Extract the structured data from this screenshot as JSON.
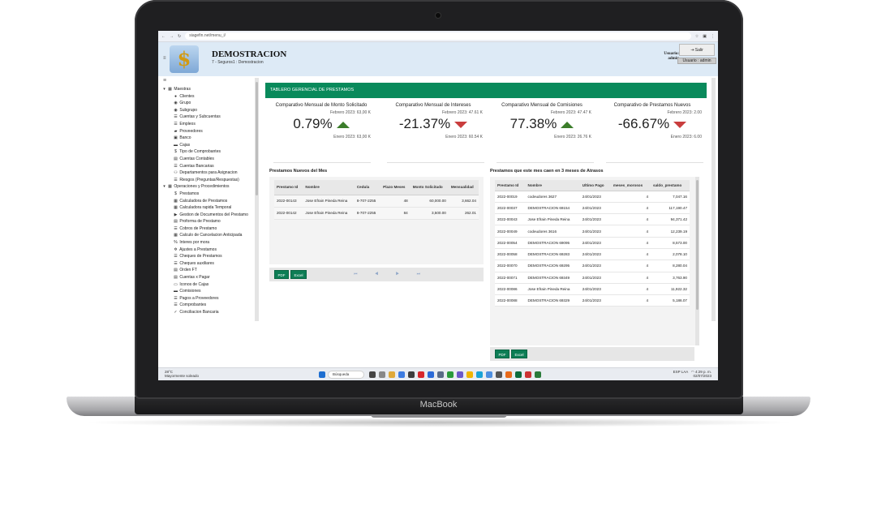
{
  "device": {
    "brand": "MacBook"
  },
  "browser": {
    "url": "siagefin.net/menu_i/"
  },
  "app": {
    "title": "DEMOSTRACION",
    "subtitle": "7 - Seguros1 : Demostracion",
    "user_label": "Usuario:",
    "user_name": "admin",
    "logout_label": "Salir",
    "user_button": "Usuario : admin"
  },
  "sidebar": {
    "items": [
      {
        "label": "Maestras",
        "icon": "grid-icon",
        "level": 0
      },
      {
        "label": "Clientes",
        "icon": "user-icon",
        "level": 1
      },
      {
        "label": "Grupo",
        "icon": "group-icon",
        "level": 1
      },
      {
        "label": "Subgrupo",
        "icon": "group-icon",
        "level": 1
      },
      {
        "label": "Cuentas y Subcuentas",
        "icon": "list-icon",
        "level": 1
      },
      {
        "label": "Empleos",
        "icon": "list-icon",
        "level": 1
      },
      {
        "label": "Proveedores",
        "icon": "truck-icon",
        "level": 1
      },
      {
        "label": "Banco",
        "icon": "bank-icon",
        "level": 1
      },
      {
        "label": "Cajas",
        "icon": "cash-icon",
        "level": 1
      },
      {
        "label": "Tipo de Comprobantes",
        "icon": "dollar-icon",
        "level": 1
      },
      {
        "label": "Cuentas Contables",
        "icon": "book-icon",
        "level": 1
      },
      {
        "label": "Cuentas Bancarias",
        "icon": "list-icon",
        "level": 1
      },
      {
        "label": "Departamentos para Asignacion",
        "icon": "org-icon",
        "level": 1
      },
      {
        "label": "Riesgos (Preguntas/Respuestas)",
        "icon": "list-icon",
        "level": 1
      },
      {
        "label": "Operaciones y Procedimientos",
        "icon": "grid-icon",
        "level": 0
      },
      {
        "label": "Prestamos",
        "icon": "dollar-icon",
        "level": 1
      },
      {
        "label": "Calculadora de Prestamos",
        "icon": "calc-icon",
        "level": 1
      },
      {
        "label": "Calculadora rapida Temporal",
        "icon": "calc-icon",
        "level": 1
      },
      {
        "label": "Gestion de Documentos del Prestamo",
        "icon": "folder-icon",
        "level": 1
      },
      {
        "label": "Proforma de Prestamo",
        "icon": "doc-icon",
        "level": 1
      },
      {
        "label": "Cobros de Prestamo",
        "icon": "list-icon",
        "level": 1
      },
      {
        "label": "Calculo de Cancelacion Anticipada",
        "icon": "calc-icon",
        "level": 1
      },
      {
        "label": "Interes por mora",
        "icon": "percent-icon",
        "level": 1
      },
      {
        "label": "Ajustes a Prestamos",
        "icon": "gear-icon",
        "level": 1
      },
      {
        "label": "Cheques de Prestamos",
        "icon": "list-icon",
        "level": 1
      },
      {
        "label": "Cheques auxiliares",
        "icon": "list-icon",
        "level": 1
      },
      {
        "label": "Orden FT",
        "icon": "doc-icon",
        "level": 1
      },
      {
        "label": "Cuentas x Pagar",
        "icon": "doc-icon",
        "level": 1
      },
      {
        "label": "Iconos de Cajas",
        "icon": "monitor-icon",
        "level": 1
      },
      {
        "label": "Comisiones",
        "icon": "cash-icon",
        "level": 1
      },
      {
        "label": "Pagos a Proveedores",
        "icon": "list-icon",
        "level": 1
      },
      {
        "label": "Comprobantes",
        "icon": "list-icon",
        "level": 1
      },
      {
        "label": "Conciliacion Bancaria",
        "icon": "check-icon",
        "level": 1
      }
    ]
  },
  "dashboard": {
    "banner": "TABLERO GERENCIAL DE PRESTAMOS",
    "kpis": [
      {
        "title": "Comparativo Mensual de Monto Solicitado",
        "prev": "Febrero 2023: 63,00 K",
        "value": "0.79%",
        "trend": "up",
        "curr": "Enero 2023: 63,00 K"
      },
      {
        "title": "Comparativo Mensual de Intereses",
        "prev": "Febrero 2023: 47.61 K",
        "value": "-21.37%",
        "trend": "down",
        "curr": "Enero 2023: 60.54 K"
      },
      {
        "title": "Comparativo Mensual de Comisiones",
        "prev": "Febrero 2023: 47.47 K",
        "value": "77.38%",
        "trend": "up",
        "curr": "Enero 2023: 26.76 K"
      },
      {
        "title": "Comparativo de Prestamos Nuevos",
        "prev": "Febrero 2023: 2.00",
        "value": "-66.67%",
        "trend": "down",
        "curr": "Enero 2023: 6.00"
      }
    ],
    "new_loans": {
      "title": "Prestamos Nuevos del Mes",
      "headers": [
        "Prestamo Id",
        "Nombre",
        "Cedula",
        "Plazo Meses",
        "Monto Solicitado",
        "Mensualidad"
      ],
      "rows": [
        [
          "2022-00143",
          "Jose Efrain Pineda Reina",
          "8-707-2255",
          "48",
          "60,000.00",
          "3,662.04"
        ],
        [
          "2022-00142",
          "Jose Efrain Pineda Reina",
          "8-707-2255",
          "84",
          "3,500.00",
          "262.01"
        ]
      ],
      "pdf": "PDF",
      "excel": "Excel",
      "pager": "⏮ ◀ ▶ ⏭"
    },
    "arrears": {
      "title": "Prestamos que este mes caen en 3 meses de Atrasos",
      "headers": [
        "Prestamo Id",
        "Nombre",
        "Ultimo Pago",
        "meses_morosos",
        "saldo_prestamo"
      ],
      "rows": [
        [
          "2022-00019",
          "codeudores 3627",
          "24/01/2023",
          "4",
          "7,047.16"
        ],
        [
          "2022-00037",
          "DEMOSTRACION 69154",
          "24/01/2023",
          "4",
          "117,190.47"
        ],
        [
          "2022-00043",
          "Jose Efrain Pineda Reina",
          "24/01/2023",
          "4",
          "94,371.42"
        ],
        [
          "2022-00049",
          "codeudores 3616",
          "24/01/2023",
          "4",
          "12,239.19"
        ],
        [
          "2022-00054",
          "DEMOSTRACION 69095",
          "24/01/2023",
          "4",
          "8,573.00"
        ],
        [
          "2022-00058",
          "DEMOSTRACION 69283",
          "24/01/2023",
          "4",
          "2,078.10"
        ],
        [
          "2022-00070",
          "DEMOSTRACION 69295",
          "24/01/2023",
          "4",
          "8,280.04"
        ],
        [
          "2022-00071",
          "DEMOSTRACION 69349",
          "24/01/2023",
          "4",
          "3,763.90"
        ],
        [
          "2022-00086",
          "Jose Efrain Pineda Reina",
          "24/01/2023",
          "4",
          "11,922.32"
        ],
        [
          "2022-00088",
          "DEMOSTRACION 69329",
          "24/01/2023",
          "4",
          "5,186.07"
        ]
      ],
      "pdf": "PDF",
      "excel": "Excel"
    }
  },
  "taskbar": {
    "weather_temp": "28°C",
    "weather_desc": "Mayormente soleado",
    "search": "Búsqueda",
    "lang": "ESP LAA",
    "time": "4:29 p. m.",
    "date": "02/07/2023"
  },
  "colors": {
    "accent": "#098a5b",
    "up": "#3b7d2a",
    "down": "#c93d3d",
    "header": "#ddeaf6"
  }
}
